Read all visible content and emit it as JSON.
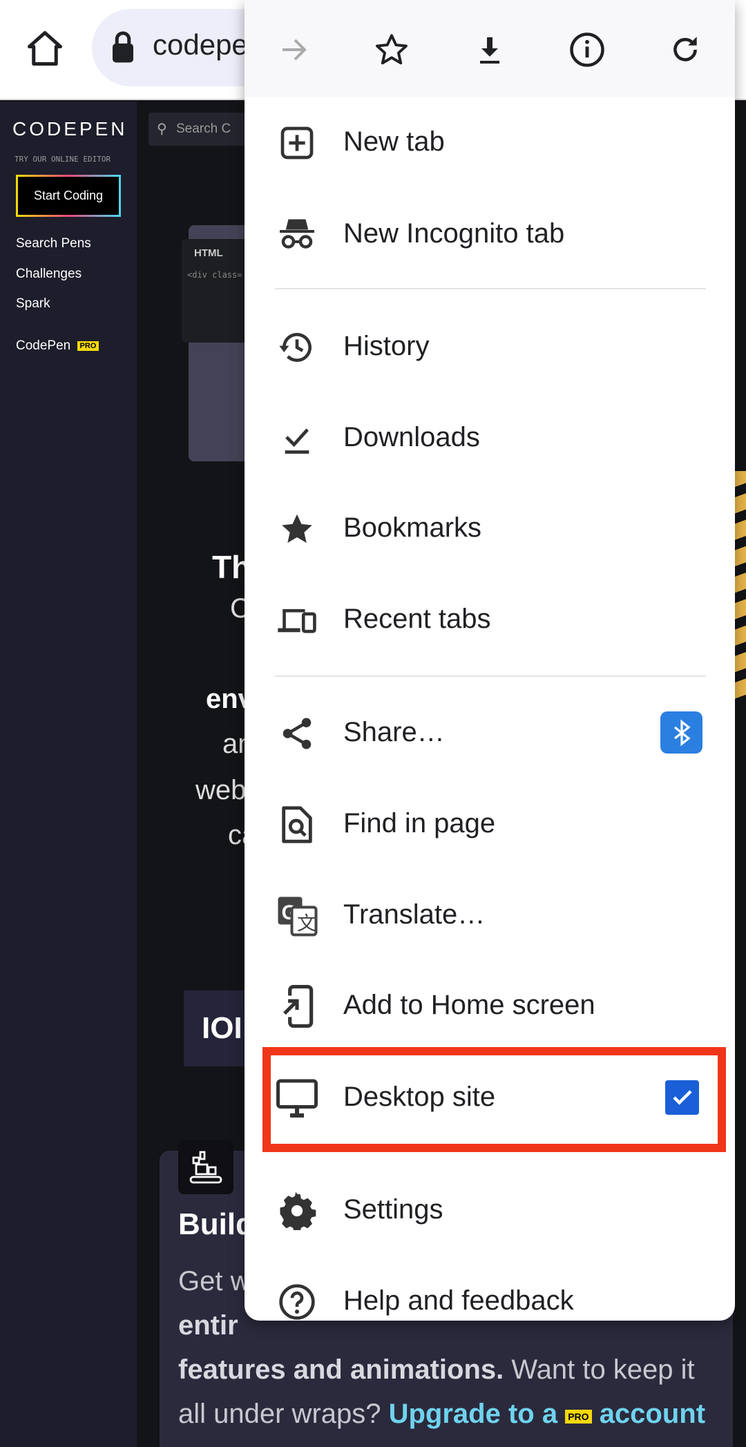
{
  "browser": {
    "url": "codepen.io",
    "url_visible": "codepe"
  },
  "toolbar": {
    "icons": [
      "forward-icon",
      "star-icon",
      "download-icon",
      "info-icon",
      "reload-icon"
    ]
  },
  "menu": {
    "items": [
      {
        "label": "New tab",
        "icon": "new-tab-icon"
      },
      {
        "label": "New Incognito tab",
        "icon": "incognito-icon"
      },
      {
        "label": "History",
        "icon": "history-icon"
      },
      {
        "label": "Downloads",
        "icon": "downloads-icon"
      },
      {
        "label": "Bookmarks",
        "icon": "bookmarks-icon"
      },
      {
        "label": "Recent tabs",
        "icon": "recent-tabs-icon"
      },
      {
        "label": "Share…",
        "icon": "share-icon"
      },
      {
        "label": "Find in page",
        "icon": "find-in-page-icon"
      },
      {
        "label": "Translate…",
        "icon": "translate-icon"
      },
      {
        "label": "Add to Home screen",
        "icon": "add-to-home-icon"
      },
      {
        "label": "Desktop site",
        "icon": "desktop-icon",
        "checked": true
      },
      {
        "label": "Settings",
        "icon": "settings-icon"
      },
      {
        "label": "Help and feedback",
        "icon": "help-icon"
      }
    ],
    "highlight_color": "#f0361a",
    "checkbox_color": "#1a5fd8",
    "bluetooth_color": "#2b7fe0"
  },
  "codepen": {
    "logo": "CODEPEN",
    "tagline": "TRY OUR ONLINE EDITOR",
    "start_button": "Start Coding",
    "nav": [
      "Search Pens",
      "Challenges",
      "Spark"
    ],
    "pro_link": "CodePen",
    "pro_badge": "PRO",
    "search_placeholder": "Search C",
    "editor_label": "HTML",
    "editor_code": "<div class=",
    "hero_fragments": [
      "Th",
      "C",
      "env",
      "an",
      "web",
      "ca"
    ],
    "stat_fragment": "IOI",
    "card": {
      "title": "Build",
      "line1": "Get w",
      "line2": "entir",
      "line3_bold": "features and animations.",
      "line3_rest": " Want to keep it",
      "line4": "all under wraps? ",
      "line4_link": "Upgrade to a",
      "line4_badge": "PRO",
      "line4_link2": "account"
    }
  }
}
